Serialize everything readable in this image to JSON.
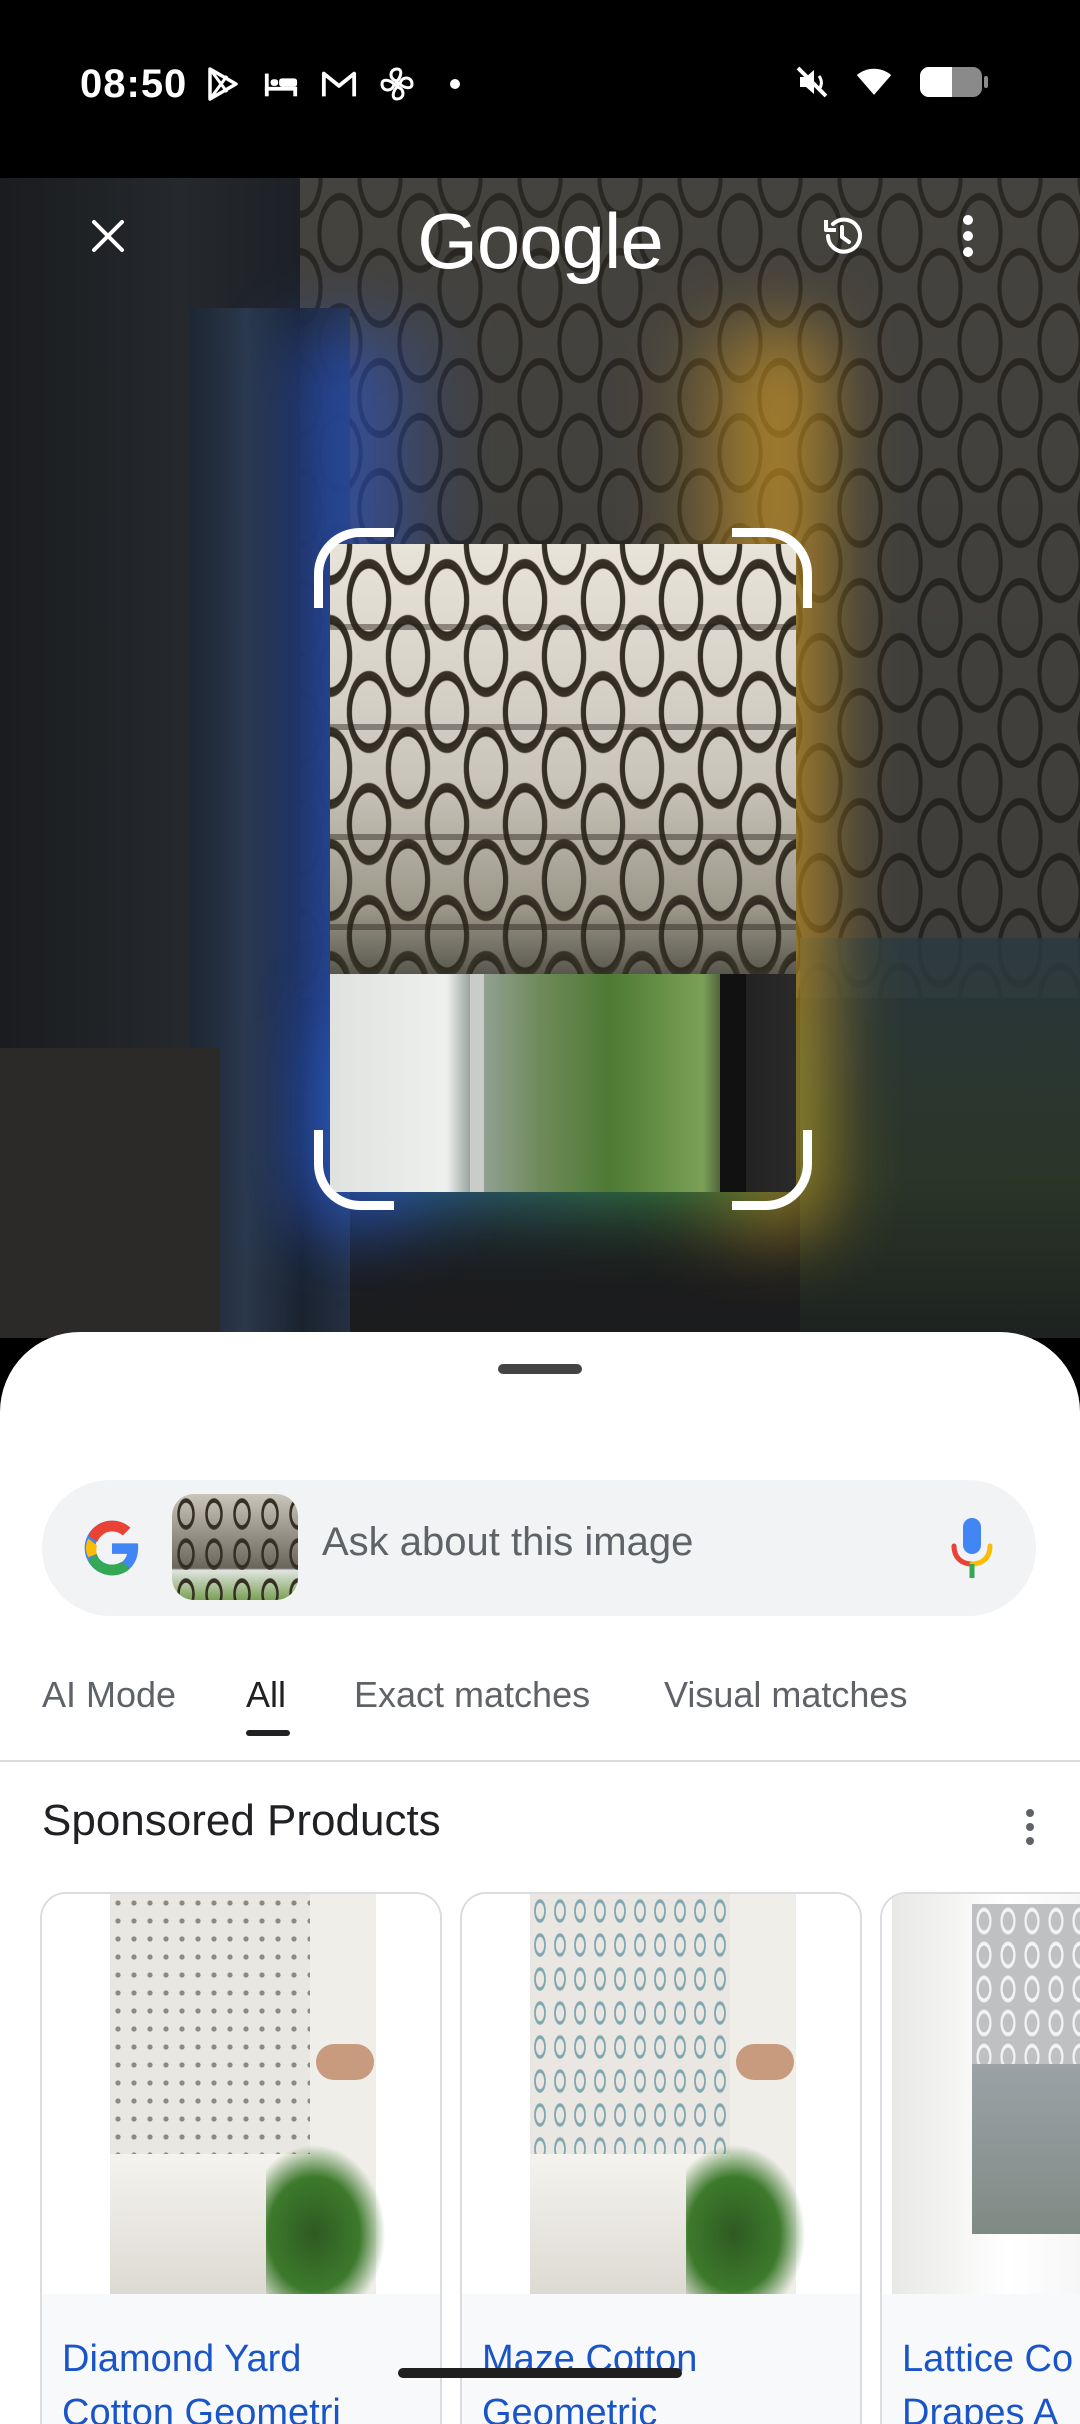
{
  "status_bar": {
    "time": "08:50",
    "left_icons": [
      "play-store-icon",
      "bed-icon",
      "gmail-icon",
      "fan-icon",
      "dot-icon"
    ],
    "right_icons": [
      "mute-icon",
      "wifi-icon",
      "battery-icon"
    ]
  },
  "header": {
    "logo_text": "Google",
    "close_icon": "close-icon",
    "history_icon": "history-icon",
    "menu_icon": "more-vert-icon"
  },
  "search": {
    "placeholder": "Ask about this image",
    "mic_icon": "mic-icon"
  },
  "tabs": [
    {
      "label": "AI Mode",
      "active": false
    },
    {
      "label": "All",
      "active": true
    },
    {
      "label": "Exact matches",
      "active": false
    },
    {
      "label": "Visual matches",
      "active": false
    }
  ],
  "section": {
    "title": "Sponsored Products"
  },
  "products": [
    {
      "title_line1": "Diamond Yard",
      "title_line2": "Cotton Geometri"
    },
    {
      "title_line1": "Maze Cotton",
      "title_line2": "Geometric"
    },
    {
      "title_line1": "Lattice Co",
      "title_line2": "Drapes A"
    }
  ],
  "colors": {
    "link": "#1a55c8",
    "google_blue": "#4285F4",
    "google_red": "#EA4335",
    "google_yellow": "#FBBC05",
    "google_green": "#34A853"
  }
}
